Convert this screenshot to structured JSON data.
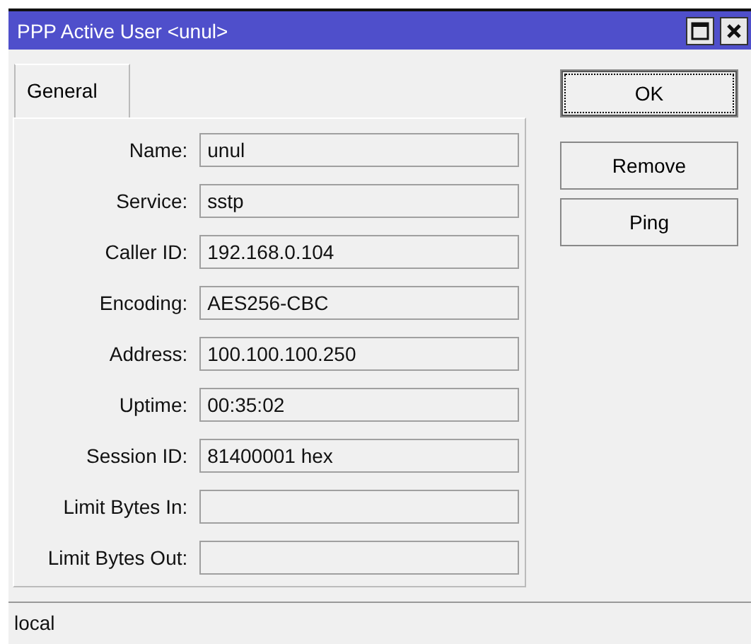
{
  "window": {
    "title": "PPP Active User <unul>"
  },
  "tabs": [
    {
      "label": "General",
      "selected": true
    }
  ],
  "fields": [
    {
      "label": "Name:",
      "value": "unul"
    },
    {
      "label": "Service:",
      "value": "sstp"
    },
    {
      "label": "Caller ID:",
      "value": "192.168.0.104"
    },
    {
      "label": "Encoding:",
      "value": "AES256-CBC"
    },
    {
      "label": "Address:",
      "value": "100.100.100.250"
    },
    {
      "label": "Uptime:",
      "value": "00:35:02"
    },
    {
      "label": "Session ID:",
      "value": "81400001 hex"
    },
    {
      "label": "Limit Bytes In:"
    },
    {
      "label": "Limit Bytes Out:"
    }
  ],
  "buttons": [
    {
      "label": "OK",
      "focused": true
    },
    {
      "label": "Remove",
      "focused": false
    },
    {
      "label": "Ping",
      "focused": false
    }
  ],
  "status_bar": "local"
}
